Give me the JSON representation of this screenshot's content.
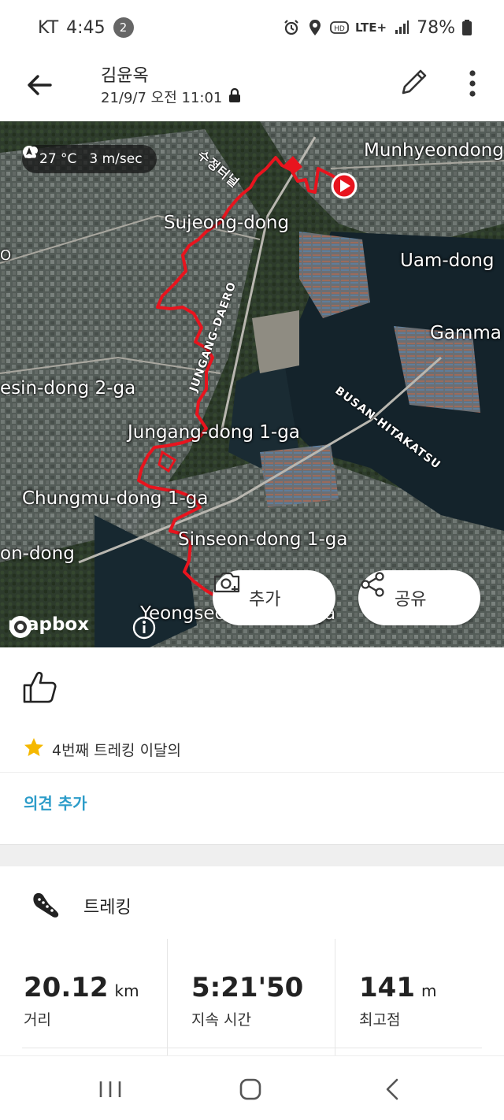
{
  "status_bar": {
    "carrier": "KT",
    "time": "4:45",
    "notification_count": "2",
    "network": "LTE+",
    "battery": "78%"
  },
  "header": {
    "name": "김윤옥",
    "datetime": "21/9/7 오전 11:01"
  },
  "map": {
    "weather": {
      "temperature": "27 °C",
      "wind": "3 m/sec"
    },
    "labels": {
      "munhyeondong": "Munhyeondong",
      "sujeong": "Sujeong-dong",
      "uam": "Uam-dong",
      "gamman": "Gamma",
      "choryang": "esin-dong 2-ga",
      "jungang": "Jungang-dong 1-ga",
      "chungmu": "Chungmu-dong 1-ga",
      "sinseon": "Sinseon-dong 1-ga",
      "nam": "on-dong",
      "yeongseon": "Yeongseon-dong 1-ga",
      "korean_road": "수정터널",
      "jungang_daero": "JUNGANG-DAERO",
      "busan_hitakatsu": "BUSAN-HITAKATSU",
      "left_edge": "O"
    },
    "add_photo_label": "추가",
    "share_label": "공유",
    "mapbox_label": "mapbox"
  },
  "social": {
    "achievement": "4번째 트레킹 이달의",
    "add_comment": "의견 추가"
  },
  "workout": {
    "title": "트레킹",
    "stats": [
      {
        "value": "20.12",
        "unit": "km",
        "label": "거리"
      },
      {
        "value": "5:21'50",
        "unit": "",
        "label": "지속 시간"
      },
      {
        "value": "141",
        "unit": "m",
        "label": "최고점"
      }
    ]
  },
  "colors": {
    "route": "#e8141e",
    "link": "#2c9cc9"
  }
}
